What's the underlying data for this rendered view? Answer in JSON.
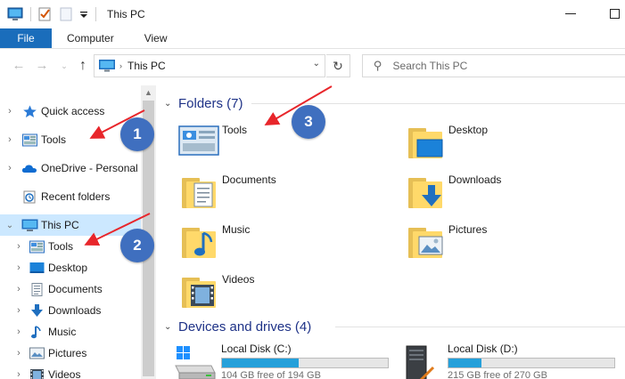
{
  "window": {
    "title": "This PC"
  },
  "ribbon": {
    "tabs": [
      "File",
      "Computer",
      "View"
    ]
  },
  "address": {
    "path": "This PC"
  },
  "search": {
    "placeholder": "Search This PC"
  },
  "nav": {
    "items": [
      {
        "label": "Quick access",
        "icon": "star-icon"
      },
      {
        "label": "Tools",
        "icon": "tools-folder-icon"
      },
      {
        "label": "OneDrive - Personal",
        "icon": "cloud-icon"
      },
      {
        "label": "Recent folders",
        "icon": "recent-folders-icon"
      },
      {
        "label": "This PC",
        "icon": "computer-icon"
      },
      {
        "label": "Tools",
        "icon": "tools-folder-icon"
      },
      {
        "label": "Desktop",
        "icon": "desktop-icon"
      },
      {
        "label": "Documents",
        "icon": "documents-icon"
      },
      {
        "label": "Downloads",
        "icon": "download-arrow-icon"
      },
      {
        "label": "Music",
        "icon": "music-note-icon"
      },
      {
        "label": "Pictures",
        "icon": "pictures-icon"
      },
      {
        "label": "Videos",
        "icon": "videos-icon"
      }
    ]
  },
  "content": {
    "folders_header": "Folders (7)",
    "folders": [
      {
        "label": "Tools",
        "icon": "tools-folder-icon"
      },
      {
        "label": "Desktop",
        "icon": "desktop-folder-icon"
      },
      {
        "label": "Documents",
        "icon": "documents-folder-icon"
      },
      {
        "label": "Downloads",
        "icon": "downloads-folder-icon"
      },
      {
        "label": "Music",
        "icon": "music-folder-icon"
      },
      {
        "label": "Pictures",
        "icon": "pictures-folder-icon"
      },
      {
        "label": "Videos",
        "icon": "videos-folder-icon"
      }
    ],
    "drives_header": "Devices and drives (4)",
    "drives": [
      {
        "label": "Local Disk (C:)",
        "free_text": "104 GB free of 194 GB",
        "used_fraction": 0.46
      },
      {
        "label": "Local Disk (D:)",
        "free_text": "215 GB free of 270 GB",
        "used_fraction": 0.2
      }
    ]
  },
  "annotations": [
    "1",
    "2",
    "3"
  ],
  "colors": {
    "accent": "#1a6dbb",
    "selection": "#cce8ff",
    "group_header": "#1e3287",
    "drive_bar": "#26a0da",
    "badge": "#3f6fbf",
    "arrow": "#e8262b"
  }
}
